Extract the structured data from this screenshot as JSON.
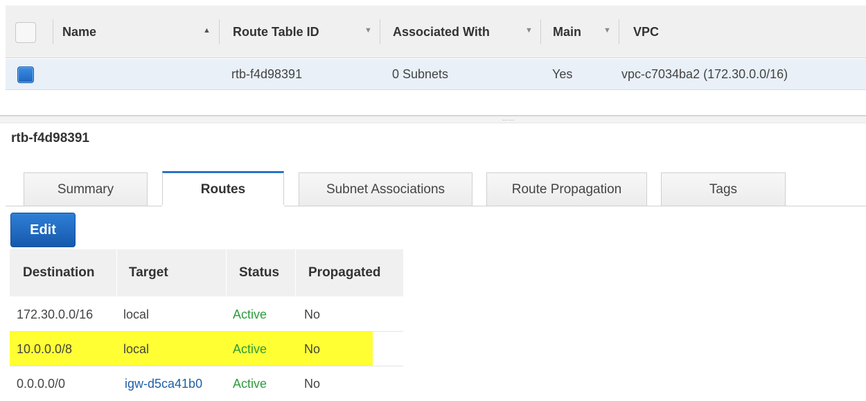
{
  "grid": {
    "columns": {
      "name": "Name",
      "route_table_id": "Route Table ID",
      "associated_with": "Associated With",
      "main": "Main",
      "vpc": "VPC"
    },
    "row": {
      "name": "",
      "route_table_id": "rtb-f4d98391",
      "associated_with": "0 Subnets",
      "main": "Yes",
      "vpc": "vpc-c7034ba2 (172.30.0.0/16)",
      "selected": true
    }
  },
  "detail": {
    "title": "rtb-f4d98391",
    "tabs": [
      {
        "label": "Summary",
        "active": false
      },
      {
        "label": "Routes",
        "active": true
      },
      {
        "label": "Subnet Associations",
        "active": false
      },
      {
        "label": "Route Propagation",
        "active": false
      },
      {
        "label": "Tags",
        "active": false
      }
    ],
    "edit_label": "Edit"
  },
  "routes": {
    "headers": {
      "destination": "Destination",
      "target": "Target",
      "status": "Status",
      "propagated": "Propagated"
    },
    "rows": [
      {
        "destination": "172.30.0.0/16",
        "target": "local",
        "status": "Active",
        "propagated": "No",
        "highlighted": false
      },
      {
        "destination": "10.0.0.0/8",
        "target": "local",
        "status": "Active",
        "propagated": "No",
        "highlighted": true
      },
      {
        "destination": "0.0.0.0/0",
        "target": "igw-d5ca41b0",
        "status": "Active",
        "propagated": "No",
        "highlighted": false
      }
    ]
  },
  "colors": {
    "primary_button": "#1f66c1",
    "active_status": "#2e9b3e",
    "link": "#1f5fa8",
    "highlight": "#ffff33",
    "selected_row": "#e9f0f8"
  }
}
